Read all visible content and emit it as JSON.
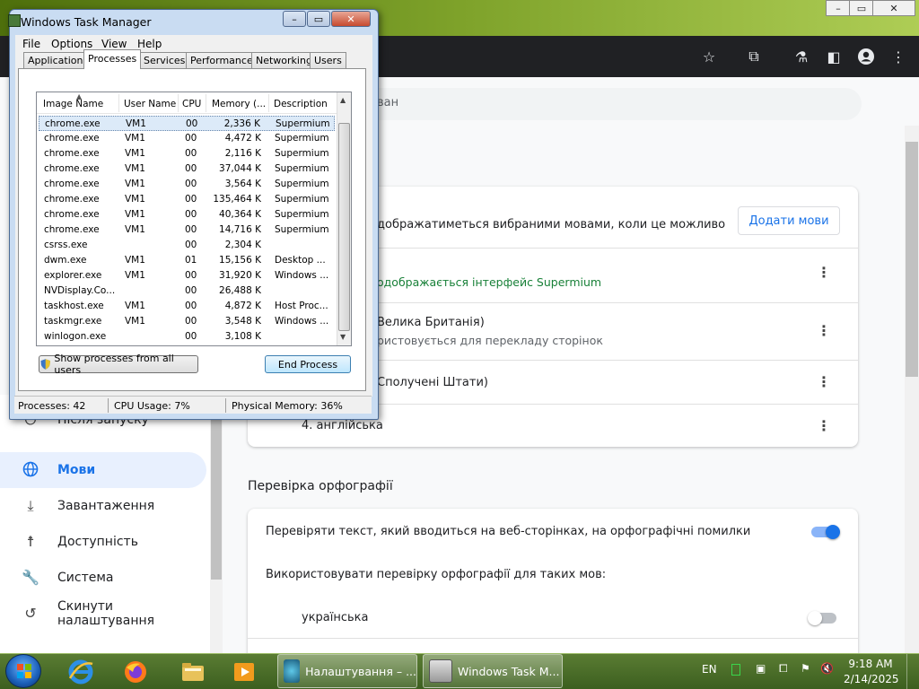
{
  "browser": {
    "search_placeholder_visible": "ван",
    "toolbar_icons": [
      "star-icon",
      "extensions-icon",
      "lab-icon",
      "side-panel-icon",
      "profile-icon",
      "menu-icon"
    ]
  },
  "languages": {
    "header_text": "дображатиметься вибраними мовами, коли це можливо",
    "add_button": "Додати мови",
    "items": [
      {
        "line1": "",
        "line2_green": "одображається інтерфейс Supermium"
      },
      {
        "line1": "Велика Британія)",
        "line2": "ристовується для перекладу сторінок"
      },
      {
        "line1": "Сполучені Штати)"
      },
      {
        "line1": "4. англійська"
      }
    ]
  },
  "spellcheck": {
    "section_title": "Перевірка орфографії",
    "check_label": "Перевіряти текст, який вводиться на веб-сторінках, на орфографічні помилки",
    "check_on": true,
    "use_for_label": "Використовувати перевірку орфографії для таких мов:",
    "lang_items": [
      {
        "name": "українська",
        "on": false
      }
    ]
  },
  "sidebar": {
    "items": [
      {
        "label": "Після запуску",
        "icon": "power-icon"
      },
      {
        "label": "Мови",
        "icon": "globe-icon",
        "active": true
      },
      {
        "label": "Завантаження",
        "icon": "download-icon"
      },
      {
        "label": "Доступність",
        "icon": "accessibility-icon"
      },
      {
        "label": "Система",
        "icon": "wrench-icon"
      },
      {
        "label": "Скинути налаштування",
        "icon": "history-icon"
      }
    ]
  },
  "taskmgr": {
    "title": "Windows Task Manager",
    "menus": [
      "File",
      "Options",
      "View",
      "Help"
    ],
    "tabs": [
      "Applications",
      "Processes",
      "Services",
      "Performance",
      "Networking",
      "Users"
    ],
    "active_tab": "Processes",
    "columns": [
      "Image Name",
      "User Name",
      "CPU",
      "Memory (...",
      "Description"
    ],
    "rows": [
      [
        "chrome.exe",
        "VM1",
        "00",
        "2,336 K",
        "Supermium"
      ],
      [
        "chrome.exe",
        "VM1",
        "00",
        "4,472 K",
        "Supermium"
      ],
      [
        "chrome.exe",
        "VM1",
        "00",
        "2,116 K",
        "Supermium"
      ],
      [
        "chrome.exe",
        "VM1",
        "00",
        "37,044 K",
        "Supermium"
      ],
      [
        "chrome.exe",
        "VM1",
        "00",
        "3,564 K",
        "Supermium"
      ],
      [
        "chrome.exe",
        "VM1",
        "00",
        "135,464 K",
        "Supermium"
      ],
      [
        "chrome.exe",
        "VM1",
        "00",
        "40,364 K",
        "Supermium"
      ],
      [
        "chrome.exe",
        "VM1",
        "00",
        "14,716 K",
        "Supermium"
      ],
      [
        "csrss.exe",
        "",
        "00",
        "2,304 K",
        ""
      ],
      [
        "dwm.exe",
        "VM1",
        "01",
        "15,156 K",
        "Desktop ..."
      ],
      [
        "explorer.exe",
        "VM1",
        "00",
        "31,920 K",
        "Windows ..."
      ],
      [
        "NVDisplay.Co...",
        "",
        "00",
        "26,488 K",
        ""
      ],
      [
        "taskhost.exe",
        "VM1",
        "00",
        "4,872 K",
        "Host Proc..."
      ],
      [
        "taskmgr.exe",
        "VM1",
        "00",
        "3,548 K",
        "Windows ..."
      ],
      [
        "winlogon.exe",
        "",
        "00",
        "3,108 K",
        ""
      ]
    ],
    "selected_row": 0,
    "show_all_button": "Show processes from all users",
    "end_process_button": "End Process",
    "status": {
      "processes": "Processes: 42",
      "cpu": "CPU Usage: 7%",
      "memory": "Physical Memory: 36%"
    }
  },
  "taskbar": {
    "buttons": [
      {
        "label": "Налаштування – ..."
      },
      {
        "label": "Windows Task M..."
      }
    ],
    "lang": "EN",
    "time": "9:18 AM",
    "date": "2/14/2025"
  }
}
